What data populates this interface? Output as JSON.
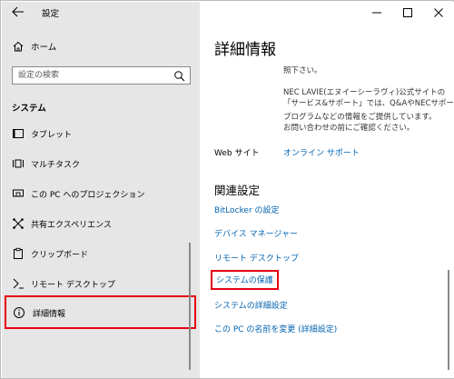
{
  "window": {
    "app_title": "設定",
    "controls": {
      "minimize_icon": "minimize-icon",
      "maximize_icon": "maximize-icon",
      "close_icon": "close-icon"
    }
  },
  "sidebar": {
    "home_label": "ホーム",
    "search": {
      "placeholder": "設定の検索",
      "value": ""
    },
    "section_label": "システム",
    "items": [
      {
        "label": "タブレット",
        "icon": "tablet-icon"
      },
      {
        "label": "マルチタスク",
        "icon": "multitasking-icon"
      },
      {
        "label": "この PC へのプロジェクション",
        "icon": "projection-icon"
      },
      {
        "label": "共有エクスペリエンス",
        "icon": "shared-experiences-icon"
      },
      {
        "label": "クリップボード",
        "icon": "clipboard-icon"
      },
      {
        "label": "リモート デスクトップ",
        "icon": "remote-desktop-icon"
      },
      {
        "label": "詳細情報",
        "icon": "info-icon",
        "active": true
      }
    ]
  },
  "main": {
    "title": "詳細情報",
    "info_lines": [
      "照下さい。",
      "NEC LAVIE(エヌイーシーラヴィ)公式サイトの",
      "「サービス&サポート」では、Q&AやNECサポート",
      "プログラムなどの情報をご提供しています。",
      "お問い合わせの前にご確認ください。"
    ],
    "web_label": "Web サイト",
    "web_link": "オンライン サポート",
    "related_title": "関連設定",
    "related_links": [
      "BitLocker の設定",
      "デバイス マネージャー",
      "リモート デスクトップ",
      "システムの保護",
      "システムの詳細設定",
      "この PC の名前を変更 (詳細設定)"
    ]
  },
  "colors": {
    "sidebar_bg": "#e6e6e6",
    "link": "#0063b1",
    "highlight": "#e60012"
  }
}
